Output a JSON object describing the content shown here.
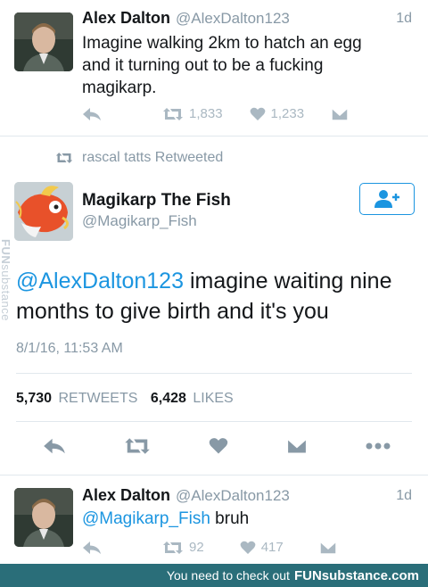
{
  "tweet1": {
    "name": "Alex Dalton",
    "handle": "@AlexDalton123",
    "time": "1d",
    "text": "Imagine walking 2km to hatch an egg and it turning out to be a fucking magikarp.",
    "retweets": "1,833",
    "likes": "1,233"
  },
  "retweet_notice": {
    "text": "rascal tatts Retweeted"
  },
  "tweet2": {
    "name": "Magikarp The Fish",
    "handle": "@Magikarp_Fish",
    "mention": "@AlexDalton123",
    "text": " imagine waiting nine months to give birth and it's you",
    "timestamp": "8/1/16, 11:53 AM",
    "retweets_count": "5,730",
    "retweets_label": "RETWEETS",
    "likes_count": "6,428",
    "likes_label": "LIKES"
  },
  "tweet3": {
    "name": "Alex Dalton",
    "handle": "@AlexDalton123",
    "time": "1d",
    "mention": "@Magikarp_Fish",
    "text": " bruh",
    "retweets": "92",
    "likes": "417"
  },
  "watermark": {
    "brand_bold": "FUN",
    "brand_rest": "substance"
  },
  "footer": {
    "text": "You need to check out",
    "brand": "FUNsubstance.com"
  },
  "colors": {
    "link": "#1b95e0",
    "muted": "#8899a6",
    "icon": "#aab8c2",
    "footer_bg": "#2a6e79"
  }
}
